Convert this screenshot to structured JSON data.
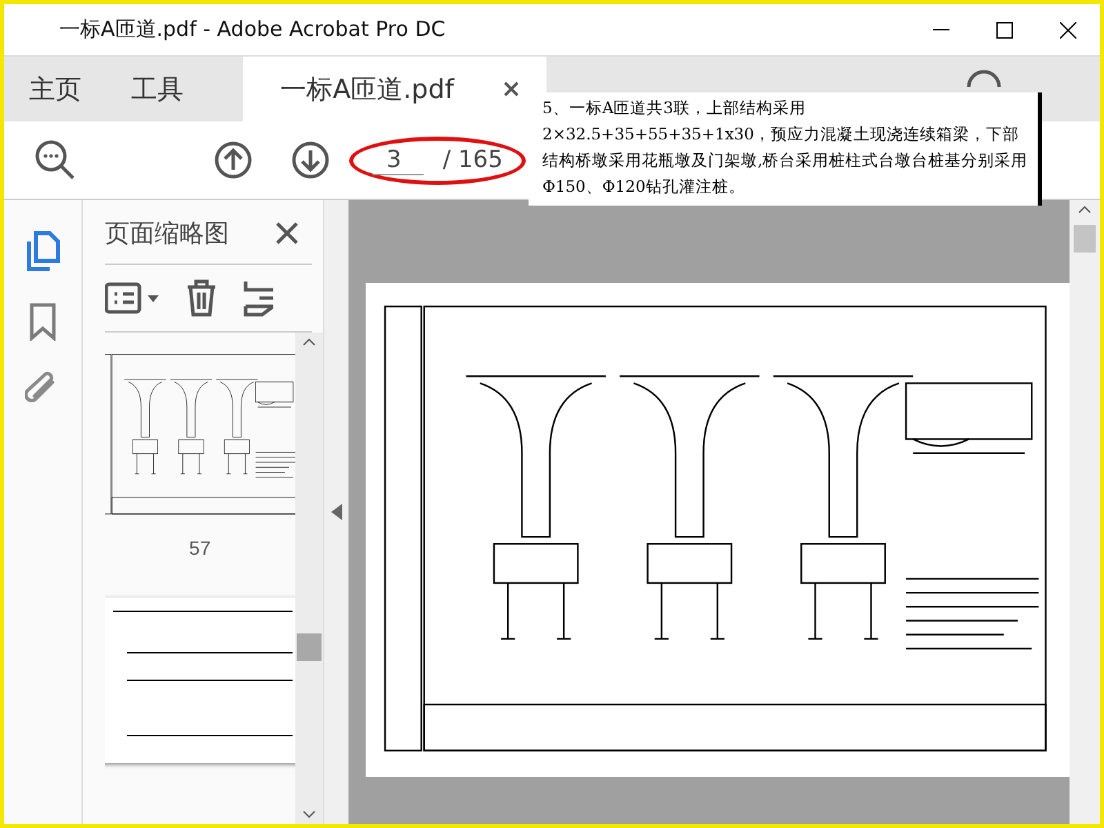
{
  "window": {
    "title": "一标A匝道.pdf - Adobe Acrobat Pro DC"
  },
  "tabs": [
    {
      "label": "主页",
      "selected": false
    },
    {
      "label": "工具",
      "selected": false
    },
    {
      "label": "一标A匝道.pdf",
      "selected": true,
      "closable": true
    }
  ],
  "toolbar": {
    "page_current": "3",
    "page_total": "/ 165",
    "highlighted": true
  },
  "note": {
    "text": "5、一标A匝道共3联，上部结构采用2×32.5+35+55+35+1x30，预应力混凝土现浇连续箱梁，下部结构桥墩采用花瓶墩及门架墩,桥台采用桩柱式台墩台桩基分别采用Φ150、Φ120钻孔灌注桩。"
  },
  "rail": [
    {
      "kind": "pages",
      "selected": true
    },
    {
      "kind": "bookmark",
      "selected": false
    },
    {
      "kind": "attachment",
      "selected": false
    }
  ],
  "thumbnails_panel": {
    "title": "页面缩略图",
    "pages": [
      {
        "label": "57"
      }
    ]
  }
}
